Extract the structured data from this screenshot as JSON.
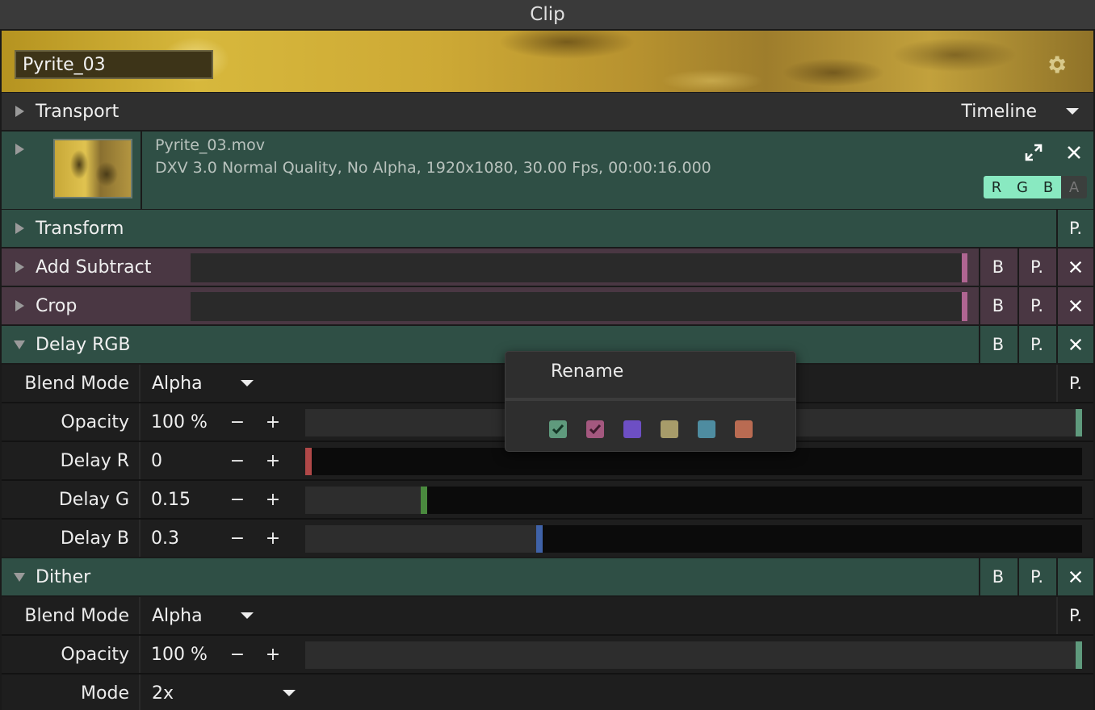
{
  "window": {
    "title": "Clip"
  },
  "clip": {
    "name": "Pyrite_03"
  },
  "transport": {
    "label": "Transport",
    "mode": "Timeline"
  },
  "media": {
    "file_name": "Pyrite_03.mov",
    "file_info": "DXV 3.0 Normal Quality, No Alpha, 1920x1080, 30.00 Fps, 00:00:16.000",
    "channels": [
      "R",
      "G",
      "B",
      "A"
    ]
  },
  "transform": {
    "label": "Transform",
    "p_label": "P."
  },
  "buttons": {
    "bypass": "B",
    "preset": "P."
  },
  "effects": {
    "add_subtract": {
      "label": "Add Subtract"
    },
    "crop": {
      "label": "Crop"
    },
    "delay_rgb": {
      "label": "Delay RGB",
      "blend_mode_label": "Blend Mode",
      "blend_mode_value": "Alpha",
      "opacity_label": "Opacity",
      "opacity_value": "100 %",
      "opacity_level": 1.0,
      "delay_r_label": "Delay R",
      "delay_r_value": "0",
      "delay_r_level": 0.0,
      "delay_g_label": "Delay G",
      "delay_g_value": "0.15",
      "delay_g_level": 0.15,
      "delay_b_label": "Delay B",
      "delay_b_value": "0.3",
      "delay_b_level": 0.3
    },
    "dither": {
      "label": "Dither",
      "blend_mode_label": "Blend Mode",
      "blend_mode_value": "Alpha",
      "opacity_label": "Opacity",
      "opacity_value": "100 %",
      "opacity_level": 1.0,
      "mode_label": "Mode",
      "mode_value": "2x"
    }
  },
  "stepper": {
    "minus": "−",
    "plus": "+"
  },
  "context_menu": {
    "rename": "Rename",
    "colors": [
      "#5f9a7d",
      "#a4587f",
      "#6d4fc4",
      "#a79c6a",
      "#4e8ca0",
      "#b96b52"
    ]
  },
  "colors": {
    "green_row": "#2f4f45",
    "pink_row": "#4a3743",
    "channel_on": "#89e9c1",
    "opacity_knob": "#5f9a7d",
    "delay_r_knob": "#b04848",
    "delay_g_knob": "#4a8a3e",
    "delay_b_knob": "#3f62a8"
  }
}
